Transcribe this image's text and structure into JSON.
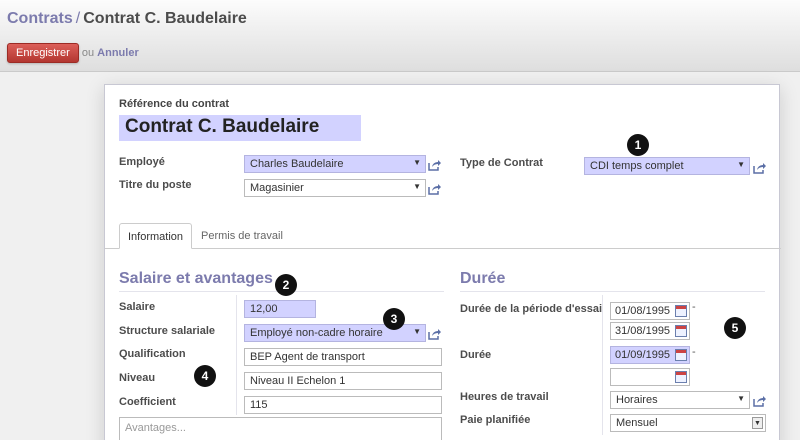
{
  "breadcrumb": {
    "parent": "Contrats",
    "separator": "/",
    "current": "Contrat C. Baudelaire"
  },
  "actions": {
    "save_label": "Enregistrer",
    "or_text": "ou",
    "cancel_label": "Annuler"
  },
  "form": {
    "reference_label": "Référence du contrat",
    "reference_value": "Contrat C. Baudelaire",
    "employee_label": "Employé",
    "employee_value": "Charles Baudelaire",
    "job_label": "Titre du poste",
    "job_value": "Magasinier",
    "contract_type_label": "Type de Contrat",
    "contract_type_value": "CDI temps complet"
  },
  "tabs": [
    {
      "label": "Information"
    },
    {
      "label": "Permis de travail"
    }
  ],
  "salary_section": {
    "title": "Salaire et avantages",
    "wage_label": "Salaire",
    "wage_value": "12,00",
    "structure_label": "Structure salariale",
    "structure_value": "Employé non-cadre horaire",
    "qualification_label": "Qualification",
    "qualification_value": "BEP Agent de transport",
    "level_label": "Niveau",
    "level_value": "Niveau II Echelon 1",
    "coefficient_label": "Coefficient",
    "coefficient_value": "115",
    "advantages_placeholder": "Avantages..."
  },
  "duration_section": {
    "title": "Durée",
    "trial_label": "Durée de la période d'essai",
    "trial_start": "01/08/1995",
    "trial_end": "31/08/1995",
    "duration_label": "Durée",
    "duration_start": "01/09/1995",
    "duration_end": "",
    "hours_label": "Heures de travail",
    "hours_value": "Horaires",
    "pay_label": "Paie planifiée",
    "pay_value": "Mensuel",
    "dash": "-"
  },
  "badges": [
    "1",
    "2",
    "3",
    "4",
    "5"
  ]
}
